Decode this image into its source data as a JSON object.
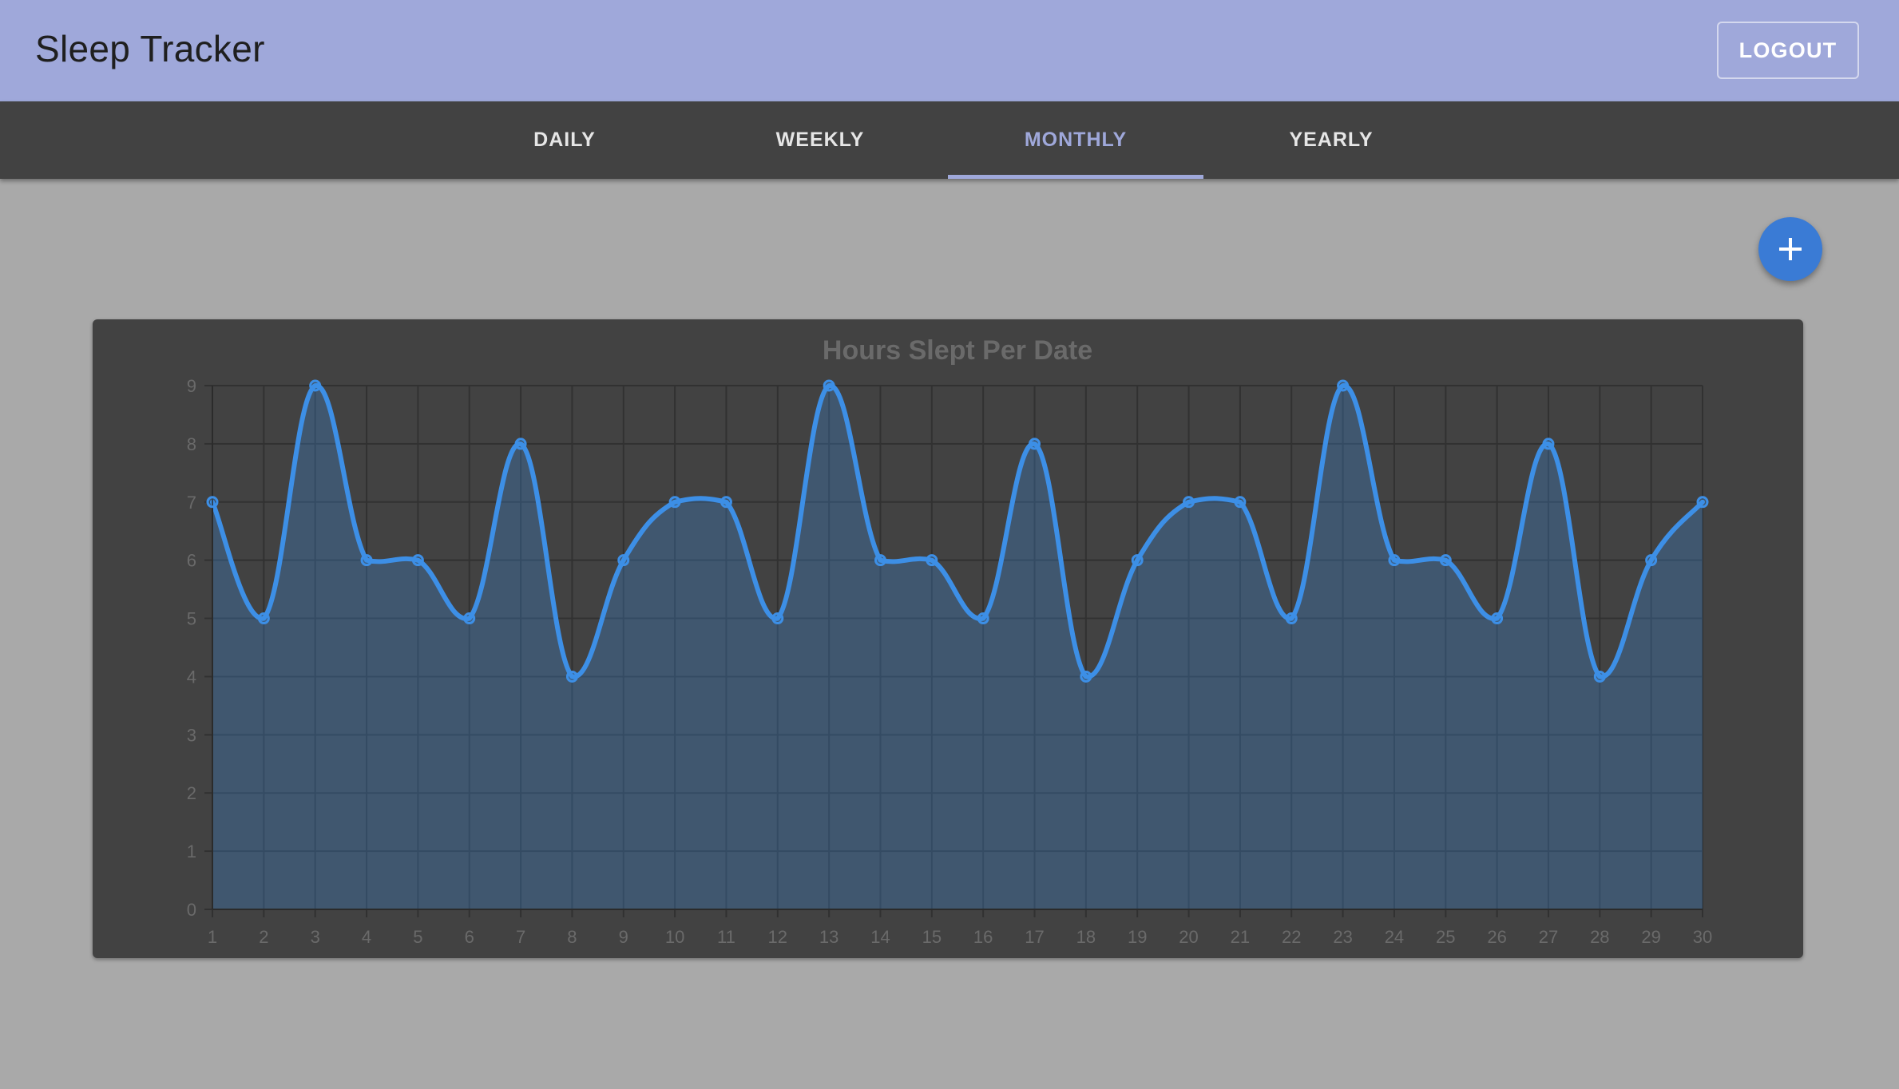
{
  "app": {
    "title": "Sleep Tracker",
    "logout_label": "LOGOUT"
  },
  "tabs": [
    {
      "label": "DAILY"
    },
    {
      "label": "WEEKLY"
    },
    {
      "label": "MONTHLY"
    },
    {
      "label": "YEARLY"
    }
  ],
  "active_tab": "MONTHLY",
  "fab": {
    "icon": "plus-icon"
  },
  "colors": {
    "appbar": "#9fa8da",
    "accent": "#9fa8da",
    "tabbar": "#424242",
    "line": "#3d8fe6",
    "fab": "#3a7bd5"
  },
  "chart_data": {
    "type": "area",
    "title": "Hours Slept Per Date",
    "xlabel": "",
    "ylabel": "",
    "x": [
      1,
      2,
      3,
      4,
      5,
      6,
      7,
      8,
      9,
      10,
      11,
      12,
      13,
      14,
      15,
      16,
      17,
      18,
      19,
      20,
      21,
      22,
      23,
      24,
      25,
      26,
      27,
      28,
      29,
      30
    ],
    "series": [
      {
        "values": [
          7,
          5,
          9,
          6,
          6,
          5,
          8,
          4,
          6,
          7,
          7,
          5,
          9,
          6,
          6,
          5,
          8,
          4,
          6,
          7,
          7,
          5,
          9,
          6,
          6,
          5,
          8,
          4,
          6,
          7
        ]
      }
    ],
    "ylim": [
      0,
      9
    ],
    "yticks": [
      0,
      1,
      2,
      3,
      4,
      5,
      6,
      7,
      8,
      9
    ],
    "grid": true,
    "legend": "none"
  }
}
